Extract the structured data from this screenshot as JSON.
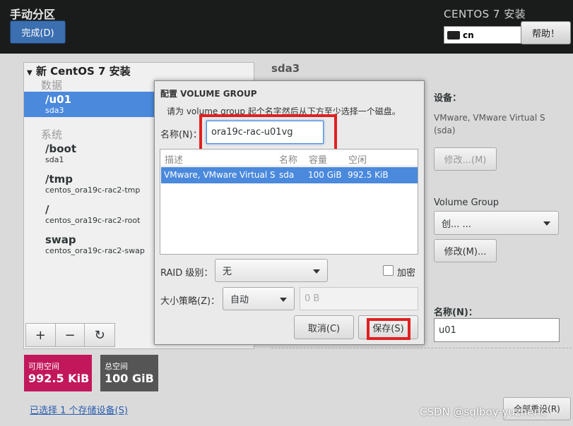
{
  "header": {
    "title": "手动分区",
    "done_label": "完成(D)",
    "product": "CENTOS 7 安装",
    "keyboard": "cn",
    "help_label": "帮助！"
  },
  "left": {
    "section": "新 CentOS 7 安装",
    "group_data": "数据",
    "group_system": "系统",
    "mountpoints": [
      {
        "name": "/u01",
        "device": "sda3"
      },
      {
        "name": "/boot",
        "device": "sda1"
      },
      {
        "name": "/tmp",
        "device": "centos_ora19c-rac2-tmp"
      },
      {
        "name": "/",
        "device": "centos_ora19c-rac2-root"
      },
      {
        "name": "swap",
        "device": "centos_ora19c-rac2-swap"
      }
    ],
    "tools": {
      "add": "+",
      "remove": "−",
      "refresh": "↻"
    },
    "avail_label": "可用空间",
    "avail_value": "992.5 KiB",
    "total_label": "总空间",
    "total_value": "100 GiB",
    "selected_link": "已选择 1 个存储设备(S)"
  },
  "right": {
    "title": "sda3",
    "device_label": "设备：",
    "device_value": "VMware, VMware Virtual S",
    "device_sub": "(sda)",
    "modify_label": "修改...(M)",
    "vg_label": "Volume Group",
    "vg_value": "创... ...",
    "modify2_label": "修改(M)...",
    "name_label": "名称(N)：",
    "name_value": "u01",
    "partial_btn": "全部重设(R)"
  },
  "dialog": {
    "title": "配置 VOLUME GROUP",
    "desc": "请为 volume group 起个名字然后从下方至少选择一个磁盘。",
    "name_label": "名称(N)：",
    "name_value": "ora19c-rac-u01vg",
    "columns": [
      "描述",
      "名称",
      "容量",
      "空闲"
    ],
    "rows": [
      {
        "desc": "VMware, VMware Virtual S",
        "name": "sda",
        "size": "100 GiB",
        "free": "992.5 KiB"
      }
    ],
    "raid_label": "RAID 级别：",
    "raid_value": "无",
    "encrypt_label": "加密",
    "size_label": "大小策略(Z)：",
    "size_value": "自动",
    "size_input": "0 B",
    "cancel_label": "取消(C)",
    "save_label": "保存(S)"
  },
  "watermark": "CSDN @sqlboy-yuzhenc",
  "colors": {
    "selection": "#4a89dc",
    "avail": "#c2185b",
    "highlight": "#e02020"
  }
}
